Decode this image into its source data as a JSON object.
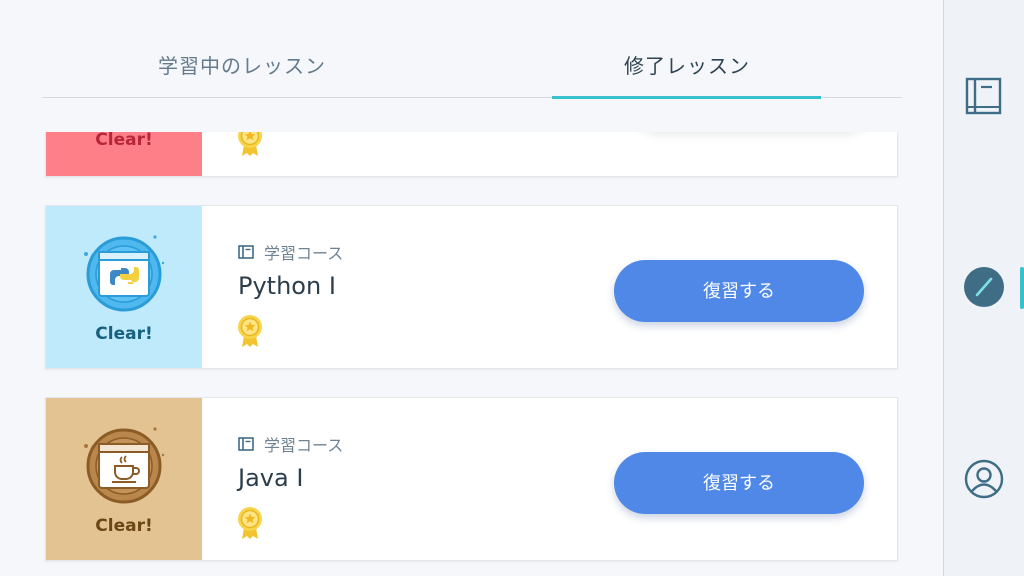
{
  "tabs": {
    "learning": "学習中のレッスン",
    "completed": "修了レッスン"
  },
  "cards": [
    {
      "clear_label": "Clear!",
      "badge_color": "#ff7f88",
      "clear_color": "#b8253a"
    },
    {
      "category": "学習コース",
      "title": "Python I",
      "clear_label": "Clear!",
      "button": "復習する",
      "badge_color": "#bfeafb",
      "clear_color": "#17607f",
      "icon": "python-logo-icon"
    },
    {
      "category": "学習コース",
      "title": "Java I",
      "clear_label": "Clear!",
      "button": "復習する",
      "badge_color": "#e3c392",
      "clear_color": "#6b4715",
      "icon": "java-cup-icon"
    }
  ],
  "sidebar": {
    "items": [
      {
        "icon": "book-icon"
      },
      {
        "icon": "pencil-icon",
        "active": true
      },
      {
        "icon": "profile-icon"
      }
    ]
  },
  "colors": {
    "accent": "#35c2cd",
    "button": "#5088e8"
  }
}
